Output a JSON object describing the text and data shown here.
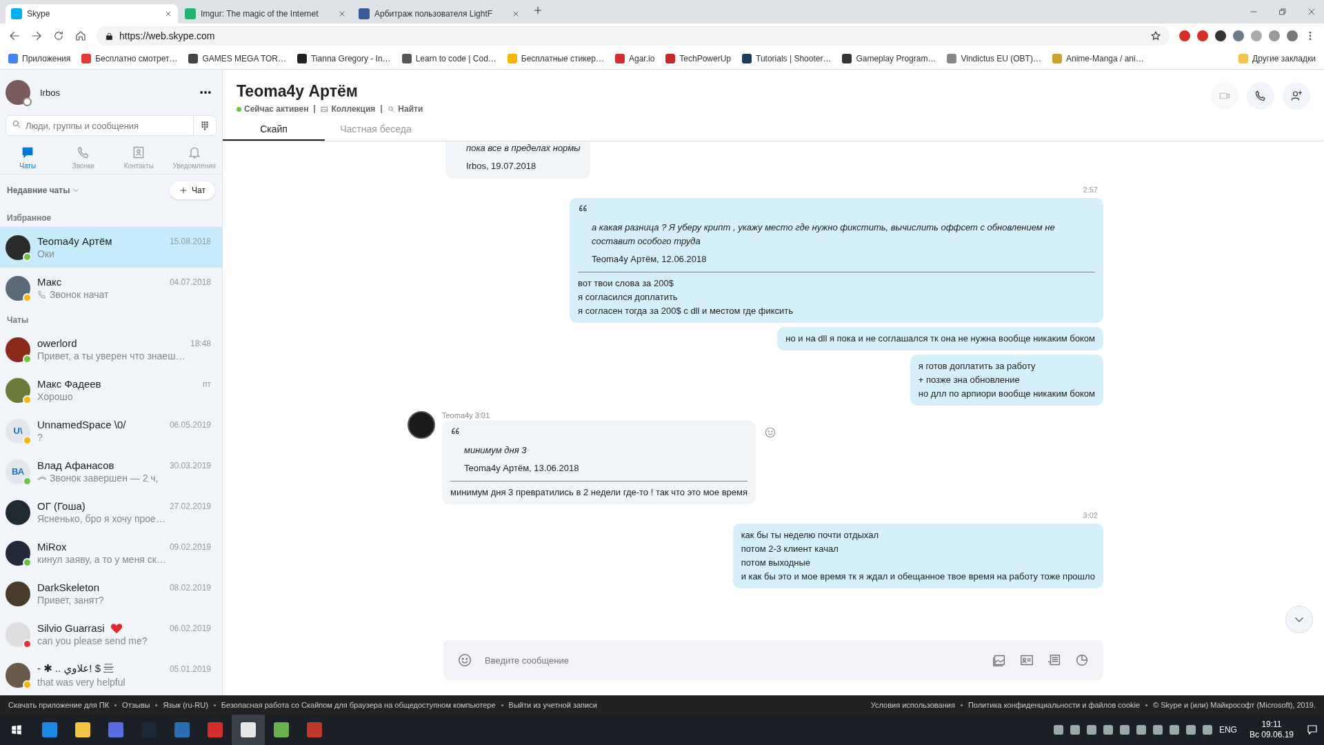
{
  "browser": {
    "tabs": [
      {
        "title": "Skype",
        "selected": true
      },
      {
        "title": "Imgur: The magic of the Internet",
        "selected": false
      },
      {
        "title": "Арбитраж пользователя LightF",
        "selected": false
      }
    ],
    "url": "https://web.skype.com",
    "bookmarks": [
      "Приложения",
      "Бесплатно смотрет…",
      "GAMES MEGA TOR…",
      "Tianna Gregory - In…",
      "Learn to code | Cod…",
      "Бесплатные стикер…",
      "Agar.io",
      "TechPowerUp",
      "Tutorials | Shooter…",
      "Gameplay Program…",
      "Vindictus EU (OBT)…",
      "Anime-Manga / ani…"
    ],
    "other_bookmarks": "Другие закладки"
  },
  "profile": {
    "name": "Irbos"
  },
  "search": {
    "placeholder": "Люди, группы и сообщения"
  },
  "nav": [
    {
      "label": "Чаты",
      "selected": true
    },
    {
      "label": "Звонки",
      "selected": false
    },
    {
      "label": "Контакты",
      "selected": false
    },
    {
      "label": "Уведомления",
      "selected": false
    }
  ],
  "recent_label": "Недавние чаты",
  "new_chat": "Чат",
  "sections": [
    {
      "title": "Избранное",
      "chats": [
        {
          "name": "Teoma4y Артём",
          "preview": {
            "kind": "text",
            "text": "Оки"
          },
          "time": "15.08.2018",
          "selected": true,
          "color": "#6bc53f",
          "kind": "photo",
          "heart": false
        },
        {
          "name": "Макс",
          "preview": {
            "kind": "call-start",
            "text": "Звонок начат"
          },
          "time": "04.07.2018",
          "selected": false,
          "color": "#f8b600",
          "kind": "photo",
          "heart": false
        }
      ]
    },
    {
      "title": "Чаты",
      "chats": [
        {
          "name": "owerlord",
          "preview": {
            "kind": "text",
            "text": "Привет, а ты уверен что знаеш…"
          },
          "time": "18:48",
          "selected": false,
          "color": "#6bc53f",
          "kind": "photo",
          "heart": false
        },
        {
          "name": "Макс Фадеев",
          "preview": {
            "kind": "text",
            "text": "Хорошо"
          },
          "time": "пт",
          "selected": false,
          "color": "#f8b600",
          "kind": "photo",
          "heart": false
        },
        {
          "name": "UnnamedSpace \\0/",
          "preview": {
            "kind": "text",
            "text": "?"
          },
          "time": "06.05.2019",
          "selected": false,
          "color": "#f8b600",
          "kind": "initials",
          "initials": "U\\",
          "heart": false
        },
        {
          "name": "Влад Афанасов",
          "preview": {
            "kind": "call-end",
            "text": "Звонок завершен — 2 ч,"
          },
          "time": "30.03.2019",
          "selected": false,
          "color": "#6bc53f",
          "kind": "initials",
          "initials": "ВА",
          "heart": false
        },
        {
          "name": "ОГ (Гоша)",
          "preview": {
            "kind": "text",
            "text": "Ясненько, бро я хочу прое…"
          },
          "time": "27.02.2019",
          "selected": false,
          "kind": "photo",
          "heart": false
        },
        {
          "name": "MiRox",
          "preview": {
            "kind": "text",
            "text": "кинул заяву, а то у меня ск…"
          },
          "time": "09.02.2019",
          "selected": false,
          "color": "#6bc53f",
          "kind": "photo",
          "heart": false
        },
        {
          "name": "DarkSkeleton",
          "preview": {
            "kind": "text",
            "text": "Привет, занят?"
          },
          "time": "08.02.2019",
          "selected": false,
          "kind": "photo",
          "heart": false
        },
        {
          "name": "Silvio Guarrasi",
          "preview": {
            "kind": "text",
            "text": "can you please send me?"
          },
          "time": "06.02.2019",
          "selected": false,
          "color": "#e3333c",
          "kind": "photo",
          "heart": true
        },
        {
          "name": "- ✱ .. علاوي! $ 亖",
          "preview": {
            "kind": "text",
            "text": "that was very helpful"
          },
          "time": "05.01.2019",
          "selected": false,
          "color": "#f8b600",
          "kind": "photo",
          "heart": false
        }
      ]
    }
  ],
  "chat": {
    "title": "Teoma4y Артём",
    "presence": "Сейчас активен",
    "links": [
      "Коллекция",
      "Найти"
    ],
    "tabs": [
      {
        "label": "Скайп",
        "selected": true
      },
      {
        "label": "Частная беседа",
        "selected": false
      }
    ],
    "messages": [
      {
        "kind": "incoming-cut",
        "quote_text": "пока все в пределах нормы",
        "quote_author": "Irbos, 19.07.2018"
      },
      {
        "kind": "time",
        "text": "2:57"
      },
      {
        "kind": "outgoing",
        "quote_text": "а какая разница ? Я уберу крипт , укажу место где нужно фикстить, вычислить оффсет с обновлением не составит особого труда",
        "quote_author": "Teoma4y Артём, 12.06.2018",
        "lines": [
          "вот твои слова за 200$",
          "я согласился доплатить",
          "я согласен тогда за 200$ с dll и местом где фиксить"
        ]
      },
      {
        "kind": "outgoing",
        "lines": [
          "но и на dll я пока и не соглашался тк она не нужна вообще никаким боком"
        ]
      },
      {
        "kind": "outgoing",
        "lines": [
          "я готов доплатить за работу",
          "+ позже зна обновление",
          "но длл по арпиори вообще никаким боком"
        ]
      },
      {
        "kind": "incoming",
        "sender": "Teoma4y 3:01",
        "quote_text": "минимум дня 3",
        "quote_author": "Teoma4y Артём, 13.06.2018",
        "lines": [
          "минимум дня 3 превратились в 2 недели где-то ! так что это мое время"
        ]
      },
      {
        "kind": "time",
        "text": "3:02"
      },
      {
        "kind": "outgoing",
        "lines": [
          "как бы ты неделю почти отдыхал",
          "потом 2-3 клиент качал",
          "потом выходные",
          "и как бы это и мое время тк я ждал и обещанное твое время на работу тоже прошло"
        ]
      }
    ],
    "composer": {
      "placeholder": "Введите сообщение"
    }
  },
  "footer": {
    "left": [
      "Скачать приложение для ПК",
      "Отзывы",
      "Язык (ru-RU)",
      "Безопасная работа со Скайпом для браузера на общедоступном компьютере",
      "Выйти из учетной записи"
    ],
    "right": [
      "Условия использования",
      "Политика конфиденциальности и файлов cookie",
      "© Skype и (или) Майкрософт (Microsoft), 2019."
    ]
  },
  "taskbar": {
    "language": "ENG",
    "time": "19:11",
    "date": "Вс 09.06.19"
  }
}
